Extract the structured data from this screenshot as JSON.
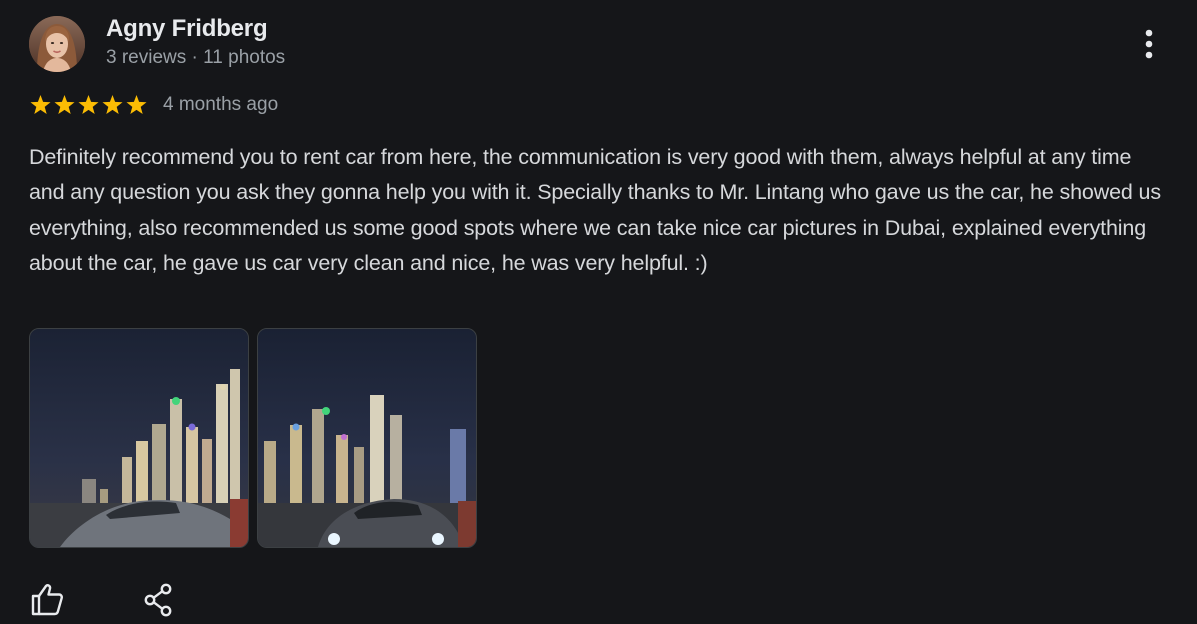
{
  "review": {
    "author": {
      "name": "Agny Fridberg",
      "meta": "3 reviews · 11 photos"
    },
    "rating": {
      "stars": 5,
      "max": 5,
      "star_color": "#fbbc04"
    },
    "date": "4 months ago",
    "text": "Definitely recommend you to rent car from here, the communication is very good with them, always helpful at any time and any question you ask they gonna help you with it. Specially thanks to Mr. Lintang who gave us the car, he showed us everything, also recommended us some good spots where we can take nice car pictures in Dubai, explained everything about the car, he gave us car very clean and nice, he was very helpful. :)",
    "photos": [
      {
        "icon": "dubai-skyline-car-photo"
      },
      {
        "icon": "dubai-skyline-car-photo"
      }
    ],
    "actions": {
      "like_icon": "thumbs-up-icon",
      "share_icon": "share-icon",
      "more_icon": "more-vertical-icon"
    }
  },
  "theme": {
    "background": "#151619",
    "text_primary": "#e8eaed",
    "text_secondary": "#9aa0a6"
  }
}
